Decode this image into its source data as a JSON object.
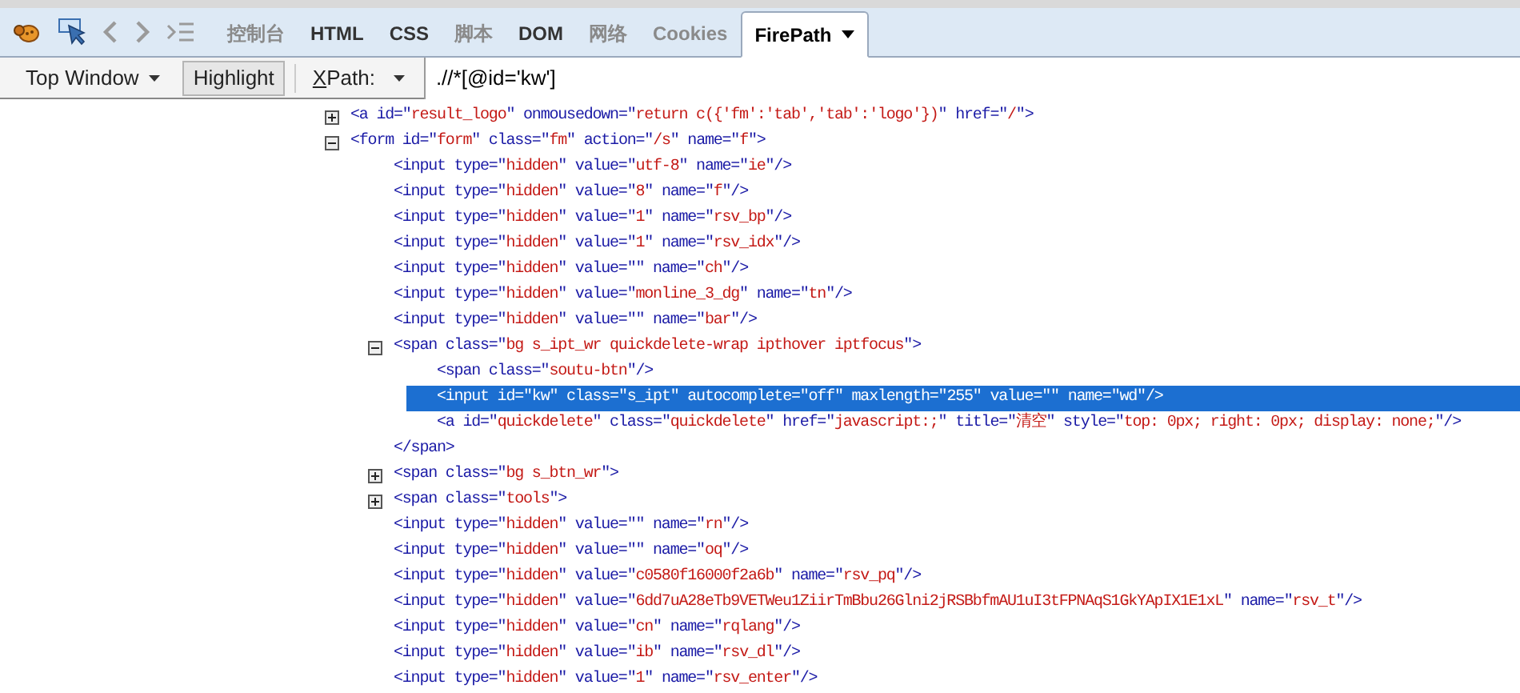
{
  "tabs": [
    {
      "label": "控制台",
      "disabled": true,
      "selected": false
    },
    {
      "label": "HTML",
      "disabled": false,
      "selected": false
    },
    {
      "label": "CSS",
      "disabled": false,
      "selected": false
    },
    {
      "label": "脚本",
      "disabled": true,
      "selected": false
    },
    {
      "label": "DOM",
      "disabled": false,
      "selected": false
    },
    {
      "label": "网络",
      "disabled": true,
      "selected": false
    },
    {
      "label": "Cookies",
      "disabled": true,
      "selected": false
    },
    {
      "label": "FirePath",
      "disabled": false,
      "selected": true
    }
  ],
  "controls": {
    "window_select": "Top Window",
    "highlight": {
      "label": "Highlight",
      "pressed": true
    },
    "xpath_label_key": "X",
    "xpath_label_rest": "Path:",
    "xpath_value": ".//*[@id='kw']"
  },
  "tree": [
    {
      "parts": [
        "<a id=\"",
        "result_logo",
        "\" onmousedown=\"",
        "return c({'fm':'tab','tab':'logo'})",
        "\" href=\"",
        "/",
        "\">"
      ],
      "expanded": false,
      "selected": false
    },
    {
      "parts": [
        "<form id=\"",
        "form",
        "\" class=\"",
        "fm",
        "\" action=\"",
        "/s",
        "\" name=\"",
        "f",
        "\">"
      ],
      "expanded": true,
      "selected": false,
      "children": [
        {
          "parts": [
            "<input type=\"",
            "hidden",
            "\" value=\"",
            "utf-8",
            "\" name=\"",
            "ie",
            "\"/>"
          ],
          "selected": false
        },
        {
          "parts": [
            "<input type=\"",
            "hidden",
            "\" value=\"",
            "8",
            "\" name=\"",
            "f",
            "\"/>"
          ],
          "selected": false
        },
        {
          "parts": [
            "<input type=\"",
            "hidden",
            "\" value=\"",
            "1",
            "\" name=\"",
            "rsv_bp",
            "\"/>"
          ],
          "selected": false
        },
        {
          "parts": [
            "<input type=\"",
            "hidden",
            "\" value=\"",
            "1",
            "\" name=\"",
            "rsv_idx",
            "\"/>"
          ],
          "selected": false
        },
        {
          "parts": [
            "<input type=\"",
            "hidden",
            "\" value=\"\" name=\"",
            "ch",
            "\"/>"
          ],
          "selected": false
        },
        {
          "parts": [
            "<input type=\"",
            "hidden",
            "\" value=\"",
            "monline_3_dg",
            "\" name=\"",
            "tn",
            "\"/>"
          ],
          "selected": false
        },
        {
          "parts": [
            "<input type=\"",
            "hidden",
            "\" value=\"\" name=\"",
            "bar",
            "\"/>"
          ],
          "selected": false
        },
        {
          "parts": [
            "<span class=\"",
            "bg s_ipt_wr quickdelete-wrap ipthover iptfocus",
            "\">"
          ],
          "expanded": true,
          "selected": false,
          "closing": [
            "</span>"
          ],
          "children": [
            {
              "parts": [
                "<span class=\"",
                "soutu-btn",
                "\"/>"
              ],
              "selected": false
            },
            {
              "parts": [
                "<input id=\"",
                "kw",
                "\" class=\"",
                "s_ipt",
                "\" autocomplete=\"",
                "off",
                "\" maxlength=\"",
                "255",
                "\" value=\"\" name=\"",
                "wd",
                "\"/>"
              ],
              "selected": true
            },
            {
              "parts": [
                "<a id=\"",
                "quickdelete",
                "\" class=\"",
                "quickdelete",
                "\" href=\"",
                "javascript:;",
                "\" title=\"",
                "清空",
                "\" style=\"",
                "top: 0px; right: 0px; display: none;",
                "\"/>"
              ],
              "selected": false
            }
          ]
        },
        {
          "parts": [
            "<span class=\"",
            "bg s_btn_wr",
            "\">"
          ],
          "expanded": false,
          "selected": false
        },
        {
          "parts": [
            "<span class=\"",
            "tools",
            "\">"
          ],
          "expanded": false,
          "selected": false
        },
        {
          "parts": [
            "<input type=\"",
            "hidden",
            "\" value=\"\" name=\"",
            "rn",
            "\"/>"
          ],
          "selected": false
        },
        {
          "parts": [
            "<input type=\"",
            "hidden",
            "\" value=\"\" name=\"",
            "oq",
            "\"/>"
          ],
          "selected": false
        },
        {
          "parts": [
            "<input type=\"",
            "hidden",
            "\" value=\"",
            "c0580f16000f2a6b",
            "\" name=\"",
            "rsv_pq",
            "\"/>"
          ],
          "selected": false
        },
        {
          "parts": [
            "<input type=\"",
            "hidden",
            "\" value=\"",
            "6dd7uA28eTb9VETWeu1ZiirTmBbu26Glni2jRSBbfmAU1uI3tFPNAqS1GkYApIX1E1xL",
            "\" name=\"",
            "rsv_t",
            "\"/>"
          ],
          "selected": false
        },
        {
          "parts": [
            "<input type=\"",
            "hidden",
            "\" value=\"",
            "cn",
            "\" name=\"",
            "rqlang",
            "\"/>"
          ],
          "selected": false
        },
        {
          "parts": [
            "<input type=\"",
            "hidden",
            "\" value=\"",
            "ib",
            "\" name=\"",
            "rsv_dl",
            "\"/>"
          ],
          "selected": false
        },
        {
          "parts": [
            "<input type=\"",
            "hidden",
            "\" value=\"",
            "1",
            "\" name=\"",
            "rsv_enter",
            "\"/>"
          ],
          "selected": false
        }
      ]
    }
  ]
}
